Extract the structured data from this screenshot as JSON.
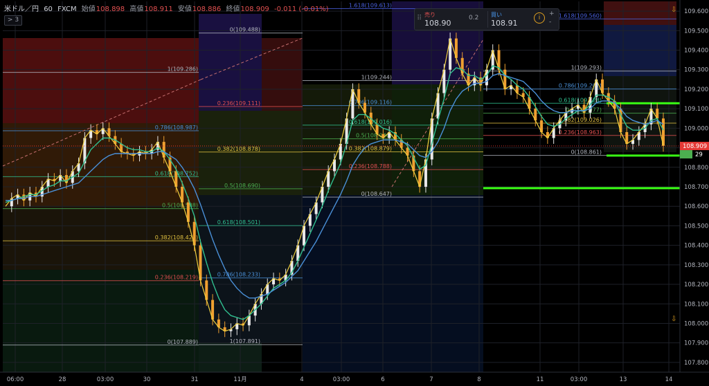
{
  "header": {
    "symbol": "米ドル／円",
    "interval": "60",
    "source": "FXCM",
    "open_label": "始値",
    "open": "108.898",
    "high_label": "高値",
    "high": "108.911",
    "low_label": "安値",
    "low": "108.886",
    "close_label": "終値",
    "close": "108.909",
    "change": "-0.011 (-0.01%)",
    "collapse_label": "> 3"
  },
  "trade_panel": {
    "sell_label": "売り",
    "sell_price": "108.90",
    "spread": "0.2",
    "buy_label": "買い",
    "buy_price": "108.91",
    "plus": "+",
    "minus": "-"
  },
  "colors": {
    "background": "#000000",
    "up": "#e8e8e8",
    "ema_fast": "#f0d040",
    "ema_mid": "#30c090",
    "ema_slow": "#4a90d8",
    "price_tag": "#e53935",
    "green_tag": "#4caf50",
    "highlight_line": "#39ff14"
  },
  "chart_data": {
    "type": "line",
    "title": "",
    "ylim": [
      107.75,
      109.65
    ],
    "y_ticks": [
      "109.600",
      "109.500",
      "109.400",
      "109.300",
      "109.200",
      "109.100",
      "109.000",
      "108.900",
      "108.800",
      "108.700",
      "108.600",
      "108.500",
      "108.400",
      "108.300",
      "108.200",
      "108.100",
      "108.000",
      "107.900",
      "107.800"
    ],
    "x_ticks": [
      "06:00",
      "28",
      "03:00",
      "30",
      "31",
      "11月",
      "4",
      "03:00",
      "6",
      "7",
      "8",
      "11",
      "03:00",
      "13",
      "14"
    ],
    "last_price": "108.909",
    "price_tag_2": "29",
    "series": [
      {
        "values": [
          108.6,
          108.64,
          108.66,
          108.63,
          108.67,
          108.65,
          108.7,
          108.74,
          108.73,
          108.76,
          108.72,
          108.78,
          108.82,
          108.95,
          108.99,
          108.97,
          109.0,
          108.96,
          108.92,
          108.88,
          108.87,
          108.86,
          108.88,
          108.87,
          108.89,
          108.93,
          108.85,
          108.78,
          108.7,
          108.62,
          108.52,
          108.4,
          108.22,
          108.12,
          108.02,
          107.98,
          107.96,
          107.97,
          108.0,
          107.99,
          108.04,
          108.1,
          108.15,
          108.2,
          108.23,
          108.22,
          108.25,
          108.32,
          108.4,
          108.5,
          108.56,
          108.62,
          108.7,
          108.78,
          108.84,
          108.92,
          109.05,
          109.2,
          109.13,
          109.08,
          109.02,
          108.97,
          108.95,
          108.98,
          108.94,
          108.9,
          108.86,
          108.78,
          108.7,
          108.84,
          109.05,
          109.18,
          109.3,
          109.46,
          109.36,
          109.28,
          109.22,
          109.26,
          109.22,
          109.3,
          109.4,
          109.3,
          109.2,
          109.22,
          109.18,
          109.16,
          109.1,
          109.04,
          108.98,
          108.95,
          109.0,
          109.04,
          109.08,
          109.1,
          109.12,
          109.08,
          109.16,
          109.25,
          109.18,
          109.14,
          109.1,
          108.98,
          108.92,
          108.94,
          108.98,
          109.02,
          109.1,
          109.05,
          108.91
        ]
      },
      {
        "values": [
          108.62,
          108.63,
          108.64,
          108.65,
          108.66,
          108.66,
          108.68,
          108.7,
          108.71,
          108.73,
          108.73,
          108.75,
          108.77,
          108.83,
          108.89,
          108.92,
          108.95,
          108.95,
          108.94,
          108.92,
          108.9,
          108.89,
          108.89,
          108.88,
          108.88,
          108.9,
          108.88,
          108.84,
          108.79,
          108.72,
          108.64,
          108.55,
          108.42,
          108.31,
          108.21,
          108.13,
          108.07,
          108.04,
          108.03,
          108.02,
          108.04,
          108.07,
          108.1,
          108.14,
          108.18,
          108.2,
          108.22,
          108.26,
          108.32,
          108.39,
          108.46,
          108.53,
          108.6,
          108.68,
          108.75,
          108.82,
          108.92,
          109.04,
          109.07,
          109.07,
          109.05,
          109.02,
          109.0,
          108.99,
          108.97,
          108.94,
          108.91,
          108.85,
          108.79,
          108.81,
          108.92,
          109.04,
          109.15,
          109.28,
          109.31,
          109.3,
          109.27,
          109.27,
          109.25,
          109.27,
          109.32,
          109.31,
          109.27,
          109.25,
          109.22,
          109.2,
          109.16,
          109.11,
          109.06,
          109.02,
          109.01,
          109.02,
          109.05,
          109.07,
          109.09,
          109.09,
          109.12,
          109.17,
          109.17,
          109.16,
          109.14,
          109.07,
          109.01,
          108.99,
          108.99,
          109.0,
          109.04,
          109.05,
          108.99
        ]
      },
      {
        "values": [
          108.63,
          108.63,
          108.64,
          108.64,
          108.65,
          108.65,
          108.66,
          108.67,
          108.68,
          108.69,
          108.7,
          108.71,
          108.72,
          108.75,
          108.78,
          108.81,
          108.84,
          108.86,
          108.87,
          108.87,
          108.87,
          108.87,
          108.87,
          108.87,
          108.87,
          108.88,
          108.88,
          108.86,
          108.84,
          108.8,
          108.75,
          108.69,
          108.61,
          108.52,
          108.43,
          108.35,
          108.28,
          108.22,
          108.18,
          108.15,
          108.13,
          108.13,
          108.14,
          108.15,
          108.17,
          108.19,
          108.21,
          108.24,
          108.27,
          108.32,
          108.37,
          108.42,
          108.48,
          108.54,
          108.6,
          108.66,
          108.73,
          108.81,
          108.86,
          108.9,
          108.92,
          108.93,
          108.94,
          108.94,
          108.94,
          108.93,
          108.92,
          108.89,
          108.86,
          108.85,
          108.88,
          108.93,
          109.0,
          109.09,
          109.15,
          109.19,
          109.21,
          109.23,
          109.23,
          109.24,
          109.27,
          109.28,
          109.27,
          109.26,
          109.25,
          109.24,
          109.21,
          109.18,
          109.14,
          109.11,
          109.09,
          109.08,
          109.08,
          109.09,
          109.09,
          109.09,
          109.1,
          109.13,
          109.14,
          109.14,
          109.13,
          109.1,
          109.06,
          109.04,
          109.03,
          109.02,
          109.03,
          109.04,
          109.02
        ]
      }
    ],
    "fib_sets": [
      {
        "levels": [
          {
            "label": "1(109.286)",
            "y": 109.286,
            "color": "#b2b5be"
          },
          {
            "label": "0.786(108.987)",
            "y": 108.987,
            "color": "#4a90d8"
          },
          {
            "label": "0.618(108.752)",
            "y": 108.752,
            "color": "#30c090"
          },
          {
            "label": "0.5(108.588)",
            "y": 108.588,
            "color": "#4caf50"
          },
          {
            "label": "0.382(108.423)",
            "y": 108.423,
            "color": "#e0c040"
          },
          {
            "label": "0.236(108.219)",
            "y": 108.219,
            "color": "#e25050"
          },
          {
            "label": "0(107.889)",
            "y": 107.889,
            "color": "#b2b5be"
          }
        ]
      },
      {
        "levels": [
          {
            "label": "0(109.488)",
            "y": 109.488,
            "color": "#b2b5be"
          },
          {
            "label": "0.236(109.111)",
            "y": 109.111,
            "color": "#e25050"
          },
          {
            "label": "0.382(108.878)",
            "y": 108.878,
            "color": "#e0c040"
          },
          {
            "label": "0.5(108.690)",
            "y": 108.69,
            "color": "#4caf50"
          },
          {
            "label": "0.618(108.501)",
            "y": 108.501,
            "color": "#30c090"
          },
          {
            "label": "0.786(108.233)",
            "y": 108.233,
            "color": "#4a90d8"
          },
          {
            "label": "1(107.891)",
            "y": 107.891,
            "color": "#b2b5be"
          }
        ]
      },
      {
        "levels": [
          {
            "label": "1.618(109.613)",
            "y": 109.613,
            "color": "#4a60e0"
          },
          {
            "label": "1(109.244)",
            "y": 109.244,
            "color": "#b2b5be"
          },
          {
            "label": "0.786(109.116)",
            "y": 109.116,
            "color": "#4a90d8"
          },
          {
            "label": "0.618(109.016)",
            "y": 109.016,
            "color": "#30c090"
          },
          {
            "label": "0.5(108.946)",
            "y": 108.946,
            "color": "#4caf50"
          },
          {
            "label": "0.382(108.879)",
            "y": 108.879,
            "color": "#e0c040"
          },
          {
            "label": "0.236(108.788)",
            "y": 108.788,
            "color": "#e25050"
          },
          {
            "label": "0(108.647)",
            "y": 108.647,
            "color": "#b2b5be"
          }
        ]
      },
      {
        "levels": [
          {
            "label": "1.618(109.560)",
            "y": 109.56,
            "color": "#4a60e0"
          },
          {
            "label": "1(109.293)",
            "y": 109.293,
            "color": "#b2b5be"
          },
          {
            "label": "0.786(109.201)",
            "y": 109.201,
            "color": "#4a90d8"
          },
          {
            "label": "0.618(109.128)",
            "y": 109.128,
            "color": "#30c090"
          },
          {
            "label": "0.5(109.077)",
            "y": 109.077,
            "color": "#4caf50"
          },
          {
            "label": "0.382(109.026)",
            "y": 109.026,
            "color": "#e0c040"
          },
          {
            "label": "0.236(108.963)",
            "y": 108.963,
            "color": "#e25050"
          },
          {
            "label": "0(108.861)",
            "y": 108.861,
            "color": "#b2b5be"
          }
        ]
      }
    ],
    "highlight_levels": [
      109.128,
      108.86,
      108.693
    ]
  }
}
